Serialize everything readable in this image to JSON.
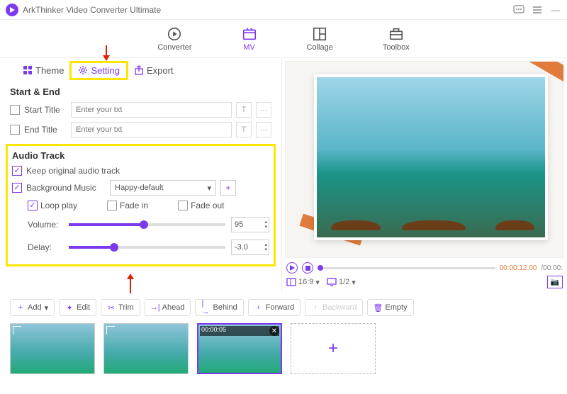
{
  "titlebar": {
    "app_name": "ArkThinker Video Converter Ultimate"
  },
  "topnav": {
    "converter": "Converter",
    "mv": "MV",
    "collage": "Collage",
    "toolbox": "Toolbox"
  },
  "tabs": {
    "theme": "Theme",
    "setting": "Setting",
    "export": "Export"
  },
  "start_end": {
    "section": "Start & End",
    "start_label": "Start Title",
    "end_label": "End Title",
    "placeholder": "Enter your txt"
  },
  "audio": {
    "section": "Audio Track",
    "keep_original": "Keep original audio track",
    "bg_music_label": "Background Music",
    "bg_music_value": "Happy-default",
    "loop": "Loop play",
    "fade_in": "Fade in",
    "fade_out": "Fade out",
    "volume_label": "Volume:",
    "volume_value": "95",
    "volume_pct": 48,
    "delay_label": "Delay:",
    "delay_value": "-3.0",
    "delay_pct": 29
  },
  "preview": {
    "current": "00:00:12.00",
    "total": "/00:00:",
    "ratio": "16:9",
    "scale": "1/2"
  },
  "toolbar": {
    "add": "Add",
    "edit": "Edit",
    "trim": "Trim",
    "ahead": "Ahead",
    "behind": "Behind",
    "forward": "Forward",
    "backward": "Backward",
    "empty": "Empty"
  },
  "thumbs": {
    "sel_ts": "00:00:05"
  }
}
